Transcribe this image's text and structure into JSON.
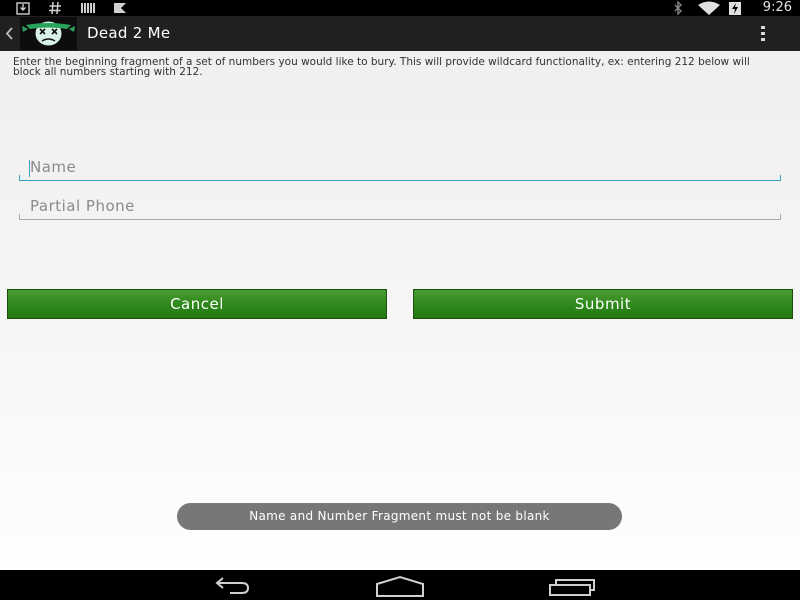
{
  "status_bar": {
    "time": "9:26",
    "left_icons": [
      "download-icon",
      "hash-icon",
      "barcode-icon",
      "flag-icon"
    ],
    "right_icons": [
      "bluetooth-icon",
      "wifi-icon",
      "battery-charging-icon"
    ]
  },
  "action_bar": {
    "title": "Dead 2 Me",
    "app_icon": "dead-face-icon",
    "up_icon": "chevron-left-icon",
    "overflow_icon": "overflow-menu-icon"
  },
  "form": {
    "instruction": "Enter the beginning fragment of a set of numbers you would like to bury. This will provide wildcard functionality, ex: entering 212 below will block all numbers starting with 212.",
    "name_value": "",
    "name_placeholder": "Name",
    "phone_value": "",
    "phone_placeholder": "Partial Phone",
    "cancel_label": "Cancel",
    "submit_label": "Submit"
  },
  "toast": {
    "message": "Name and Number Fragment must not be blank"
  },
  "nav_bar": {
    "icons": [
      "back-icon",
      "home-icon",
      "recent-apps-icon"
    ]
  },
  "colors": {
    "accent": "#3aa1c4",
    "button_green": "#2f8a1c",
    "action_bar": "#202020",
    "toast": "#777777"
  }
}
